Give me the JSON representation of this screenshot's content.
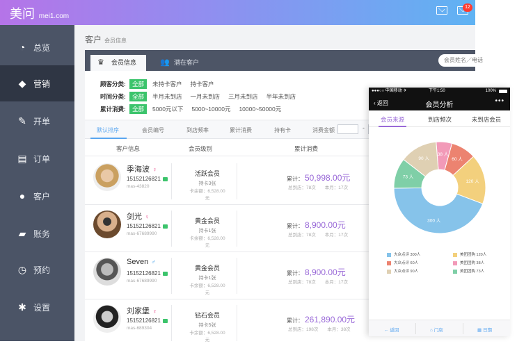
{
  "app": {
    "logo": "美问",
    "logo_domain": "mei1.com",
    "mail_badge": "12"
  },
  "sidebar": {
    "items": [
      {
        "label": "总览",
        "icon": "dashboard-icon"
      },
      {
        "label": "营销",
        "icon": "tag-icon"
      },
      {
        "label": "开单",
        "icon": "edit-icon"
      },
      {
        "label": "订单",
        "icon": "document-icon"
      },
      {
        "label": "客户",
        "icon": "person-icon"
      },
      {
        "label": "账务",
        "icon": "folder-icon"
      },
      {
        "label": "预约",
        "icon": "timer-icon"
      },
      {
        "label": "设置",
        "icon": "gear-icon"
      }
    ],
    "active": 1
  },
  "breadcrumb": {
    "title": "客户",
    "sub": "会员信息"
  },
  "tabs": [
    {
      "label": "会员信息"
    },
    {
      "label": "潜在客户"
    }
  ],
  "search": {
    "placeholder": "会员姓名／电话"
  },
  "filters": [
    {
      "label": "顾客分类:",
      "options": [
        "全部",
        "未持卡客户",
        "持卡客户"
      ]
    },
    {
      "label": "时间分类:",
      "options": [
        "全部",
        "半月未到店",
        "一月未到店",
        "三月未到店",
        "半年未到店"
      ]
    },
    {
      "label": "累计消费:",
      "options": [
        "全部",
        "5000元以下",
        "5000~10000元",
        "10000~50000元"
      ]
    }
  ],
  "sort_tabs": [
    "默认排序",
    "会员编号",
    "到店频率",
    "累计消费",
    "持有卡",
    "消费金额"
  ],
  "columns": {
    "customer": "客户信息",
    "level": "会员级别",
    "spend": "累计消费"
  },
  "rows": [
    {
      "name": "季海波",
      "gender": "♀",
      "phone": "15152126821",
      "id": "mas-43820",
      "level": "活跃会员",
      "card": "持卡3张",
      "balance": "卡余额：6,528.00元",
      "spend_prefix": "累计：",
      "spend": "50,998.00元",
      "stats": "总到店：78次　　本月：17次"
    },
    {
      "name": "剑光",
      "gender": "♀",
      "phone": "15152126821",
      "id": "mas-67689990",
      "level": "黄金会员",
      "card": "持卡1张",
      "balance": "卡余额：6,528.00元",
      "spend_prefix": "累计：",
      "spend": "8,900.00元",
      "stats": "总到店：78次　　本月：17次"
    },
    {
      "name": "Seven",
      "gender": "♂",
      "phone": "15152126821",
      "id": "mas-67689990",
      "level": "黄金会员",
      "card": "持卡1张",
      "balance": "卡余额：6,528.00元",
      "spend_prefix": "累计：",
      "spend": "8,900.00元",
      "stats": "总到店：78次　　本月：17次"
    },
    {
      "name": "刘家堡",
      "gender": "♀",
      "phone": "15152126821",
      "id": "mas-689304",
      "level": "钻石会员",
      "card": "持卡5张",
      "balance": "卡余额：6,528.00元",
      "spend_prefix": "累计：",
      "spend": "261,890.00元",
      "stats": "总到店：198次　　本月：38次"
    }
  ],
  "phone": {
    "status_left": "●●●○○ 中国移动 ✈",
    "status_time": "下午1:50",
    "status_right": "100%",
    "back": "返回",
    "title": "会员分析",
    "tabs": [
      "会员来源",
      "到店频次",
      "未到店会员"
    ],
    "bottom": [
      "返回",
      "门店",
      "日期"
    ]
  },
  "chart_data": {
    "type": "pie",
    "donut": true,
    "slices": [
      {
        "label": "大众点评",
        "value": 300,
        "color": "#86c3ea"
      },
      {
        "label": "大众点评",
        "value": 60,
        "color": "#ec8370"
      },
      {
        "label": "大众点评",
        "value": 90,
        "color": "#dfd0b3"
      },
      {
        "label": "美团团购",
        "value": 120,
        "color": "#f3d07d"
      },
      {
        "label": "美团团购",
        "value": 38,
        "color": "#f29ab8"
      },
      {
        "label": "美团团购",
        "value": 73,
        "color": "#7fcfa7"
      }
    ],
    "slice_labels": [
      "300 人",
      "60 人",
      "90 人",
      "120 人",
      "38 人",
      "73 人"
    ],
    "legend_text": [
      "大众点评 300人",
      "大众点评 60人",
      "大众点评 90人",
      "美团团购 120人",
      "美团团购 38人",
      "美团团购 73人"
    ]
  },
  "colors": {
    "accent": "#9a6ad8",
    "green": "#3cc46c",
    "sidebar": "#4b5466"
  }
}
